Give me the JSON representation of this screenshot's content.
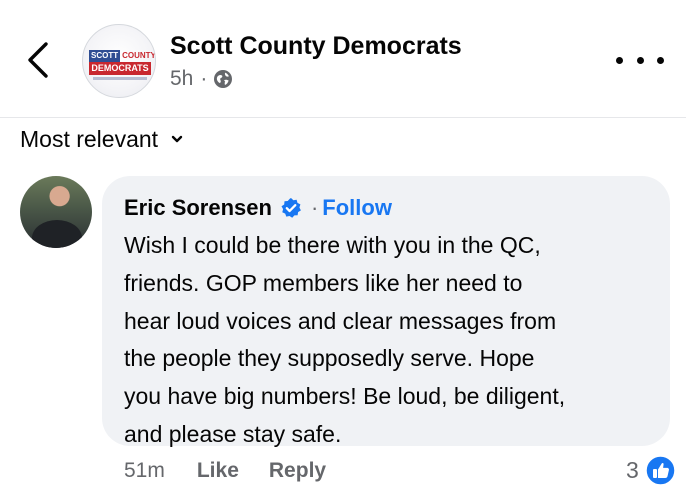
{
  "header": {
    "page_name": "Scott County Democrats",
    "time": "5h",
    "separator": "·",
    "privacy_icon": "globe-icon",
    "back_icon": "chevron-left-icon",
    "more_icon": "more-horizontal-icon",
    "logo": {
      "line1_left": "SCOTT",
      "line1_right": "COUNTY",
      "line2": "DEMOCRATS"
    }
  },
  "sort": {
    "label": "Most relevant",
    "icon": "chevron-down-icon"
  },
  "comment": {
    "author": "Eric Sorensen",
    "verified_icon": "verified-badge-icon",
    "follow_separator": "·",
    "follow_label": "Follow",
    "text_lines": [
      "Wish I could be there with you in the QC,",
      "friends. GOP members like her need to",
      "hear loud voices and clear messages from",
      "the people they supposedly serve. Hope",
      "you have big numbers! Be loud, be diligent,",
      "and please stay safe."
    ],
    "time": "51m",
    "like_label": "Like",
    "reply_label": "Reply",
    "reaction_count": "3",
    "reaction_icon": "like-reaction-icon"
  },
  "colors": {
    "accent": "#1877f2",
    "bubble": "#f0f2f5",
    "secondary_text": "#65676b",
    "logo_red": "#c8282f",
    "logo_blue": "#2f4e93"
  }
}
